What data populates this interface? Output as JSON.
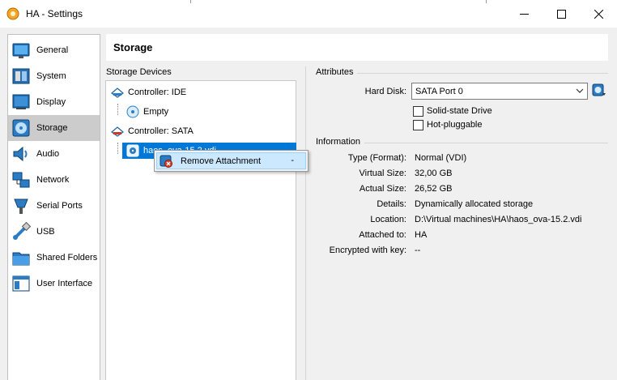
{
  "window": {
    "title": "HA - Settings",
    "controls": {
      "minimize": "—",
      "maximize": "☐",
      "close": "✕"
    }
  },
  "nav": {
    "items": [
      {
        "label": "General",
        "icon": "general-icon"
      },
      {
        "label": "System",
        "icon": "system-icon"
      },
      {
        "label": "Display",
        "icon": "display-icon"
      },
      {
        "label": "Storage",
        "icon": "storage-icon",
        "selected": true
      },
      {
        "label": "Audio",
        "icon": "audio-icon"
      },
      {
        "label": "Network",
        "icon": "network-icon"
      },
      {
        "label": "Serial Ports",
        "icon": "serial-ports-icon"
      },
      {
        "label": "USB",
        "icon": "usb-icon"
      },
      {
        "label": "Shared Folders",
        "icon": "shared-folders-icon"
      },
      {
        "label": "User Interface",
        "icon": "user-interface-icon"
      }
    ]
  },
  "page": {
    "title": "Storage"
  },
  "storage_devices": {
    "label": "Storage Devices",
    "controllers": [
      {
        "label": "Controller: IDE",
        "children": [
          "Empty"
        ]
      },
      {
        "label": "Controller: SATA",
        "children": [
          "haos_ova-15.2.vdi"
        ]
      }
    ]
  },
  "attributes": {
    "label": "Attributes",
    "hard_disk_label": "Hard Disk:",
    "hard_disk_value": "SATA Port 0",
    "solid_state_label": "Solid-state Drive",
    "solid_state_checked": false,
    "hot_pluggable_label": "Hot-pluggable",
    "hot_pluggable_checked": false
  },
  "information": {
    "label": "Information",
    "rows": [
      {
        "label": "Type (Format):",
        "value": "Normal (VDI)"
      },
      {
        "label": "Virtual Size:",
        "value": "32,00 GB"
      },
      {
        "label": "Actual Size:",
        "value": "26,52 GB"
      },
      {
        "label": "Details:",
        "value": "Dynamically allocated storage"
      },
      {
        "label": "Location:",
        "value": "D:\\Virtual machines\\HA\\haos_ova-15.2.vdi"
      },
      {
        "label": "Attached to:",
        "value": "HA"
      },
      {
        "label": "Encrypted with key:",
        "value": "--"
      }
    ]
  },
  "context_menu": {
    "items": [
      {
        "label": "Remove Attachment",
        "shortcut": "-",
        "icon": "remove-attachment-icon"
      }
    ]
  },
  "colors": {
    "selection": "#0078d7",
    "menu_highlight": "#cce8ff",
    "nav_selected": "#cccccc"
  }
}
